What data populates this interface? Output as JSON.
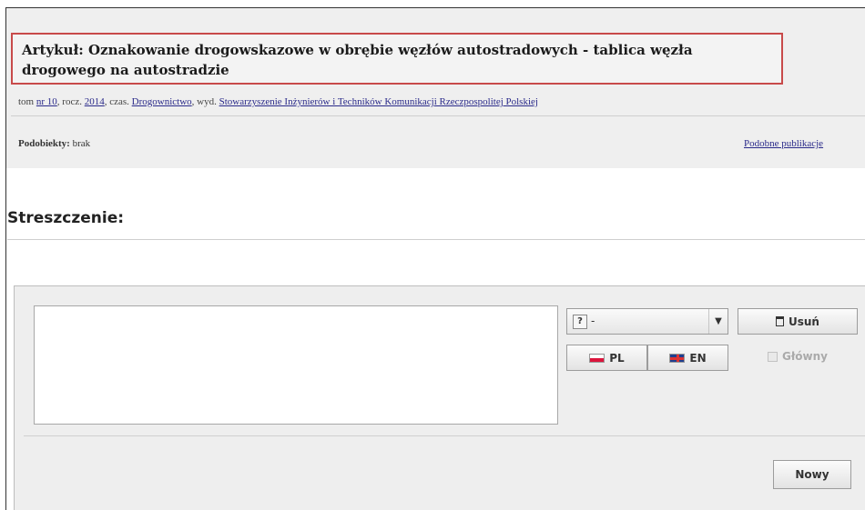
{
  "article": {
    "title_line1": "Artykuł: Oznakowanie drogowskazowe w obrębie węzłów autostradowych - tablica węzła",
    "title_line2": "drogowego na autostradzie",
    "meta_prefix": "tom",
    "meta_volume_link": "nr 10",
    "meta_year_label": ", rocz.",
    "meta_year_link": "2014",
    "meta_journal_label": ", czas.",
    "meta_journal_link": "Drogownictwo",
    "meta_publisher_label": ", wyd.",
    "meta_publisher_link": "Stowarzyszenie Inżynierów i Techników Komunikacji Rzeczpospolitej Polskiej",
    "subobjects_label": "Podobiekty:",
    "subobjects_value": "brak",
    "similar_link": "Podobne publikacje"
  },
  "abstract": {
    "heading": "Streszczenie:",
    "text_value": "",
    "language_select_value": "-",
    "btn_pl": "PL",
    "btn_en": "EN",
    "btn_delete": "Usuń",
    "main_checkbox_label": "Główny",
    "btn_new": "Nowy"
  },
  "icons": {
    "question": "question-icon",
    "trash": "trash-icon",
    "dropdown": "chevron-down-icon"
  },
  "colors": {
    "title_border": "#c84a4a",
    "link": "#2a2a8a",
    "panel_bg": "#efefef"
  }
}
